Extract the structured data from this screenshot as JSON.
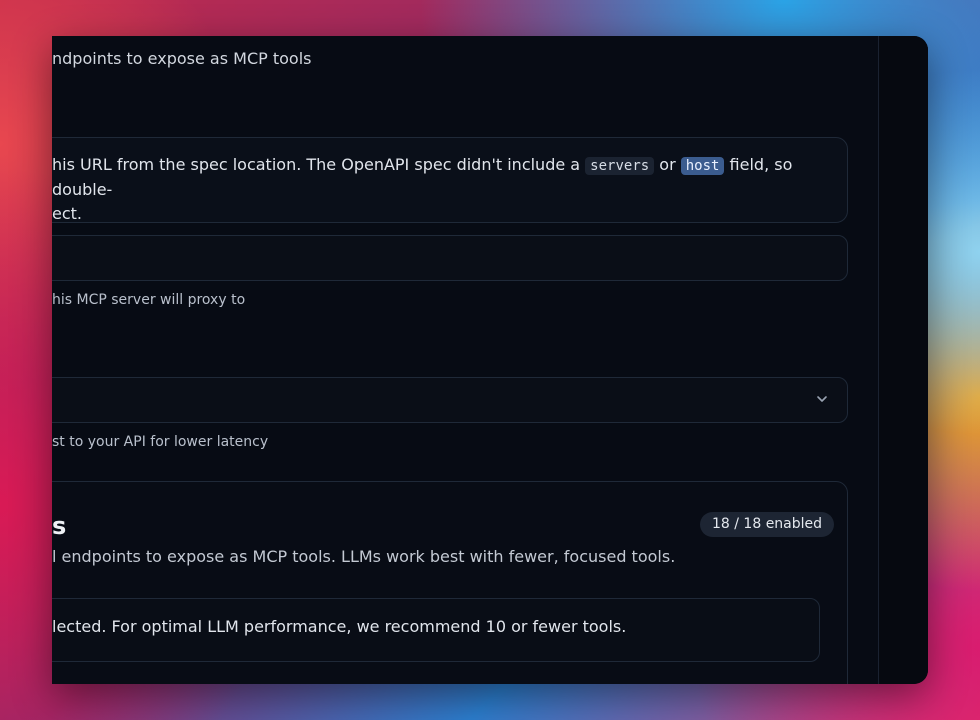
{
  "endpoints": {
    "description": "ndpoints to expose as MCP tools"
  },
  "base_url": {
    "callout_part1": "his URL from the spec location. The OpenAPI spec didn't include a ",
    "code_servers": "servers",
    "callout_or": " or ",
    "code_host": "host",
    "callout_part2": " field, so double-",
    "callout_line2": "ect.",
    "input_value": "",
    "hint": "his MCP server will proxy to"
  },
  "region": {
    "selected": "",
    "hint": "st to your API for lower latency",
    "icon": "chevron-down-icon"
  },
  "tools": {
    "title": "s",
    "badge": "18 / 18 enabled",
    "description": "l endpoints to expose as MCP tools. LLMs work best with fewer, focused tools.",
    "warning": "lected. For optimal LLM performance, we recommend 10 or fewer tools."
  }
}
